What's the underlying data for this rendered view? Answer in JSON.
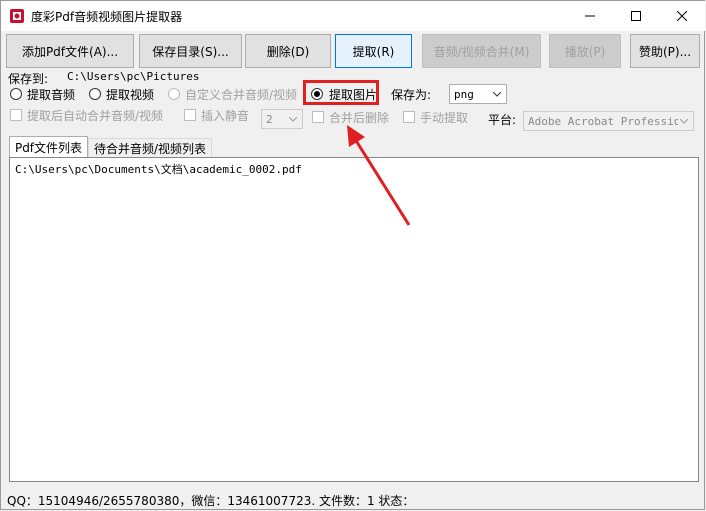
{
  "window": {
    "title": "度彩Pdf音频视频图片提取器"
  },
  "toolbar": {
    "add_pdf": "添加Pdf文件(A)...",
    "save_dir": "保存目录(S)...",
    "delete": "删除(D)",
    "extract": "提取(R)",
    "merge_av": "音频/视频合并(M)",
    "play": "播放(P)",
    "donate": "赞助(P)..."
  },
  "options": {
    "save_to_label": "保存到:",
    "save_to_path": "C:\\Users\\pc\\Pictures",
    "extract_audio": "提取音频",
    "extract_video": "提取视频",
    "custom_merge": "自定义合并音频/视频",
    "extract_image": "提取图片",
    "save_as_label": "保存为:",
    "save_as_value": "png",
    "auto_merge": "提取后自动合并音频/视频",
    "insert_silence": "插入静音",
    "silence_value": "2",
    "delete_after_merge": "合并后删除",
    "manual_extract": "手动提取",
    "platform_label": "平台:",
    "platform_value": "Adobe Acrobat Professional"
  },
  "tabs": [
    {
      "label": "Pdf文件列表"
    },
    {
      "label": "待合并音频/视频列表"
    }
  ],
  "file_list": [
    "C:\\Users\\pc\\Documents\\文档\\academic_0002.pdf"
  ],
  "status": {
    "text": "QQ：15104946/2655780380，微信：13461007723. 文件数：1  状态："
  },
  "colors": {
    "highlight": "#e02020",
    "arrow": "#e02020"
  }
}
